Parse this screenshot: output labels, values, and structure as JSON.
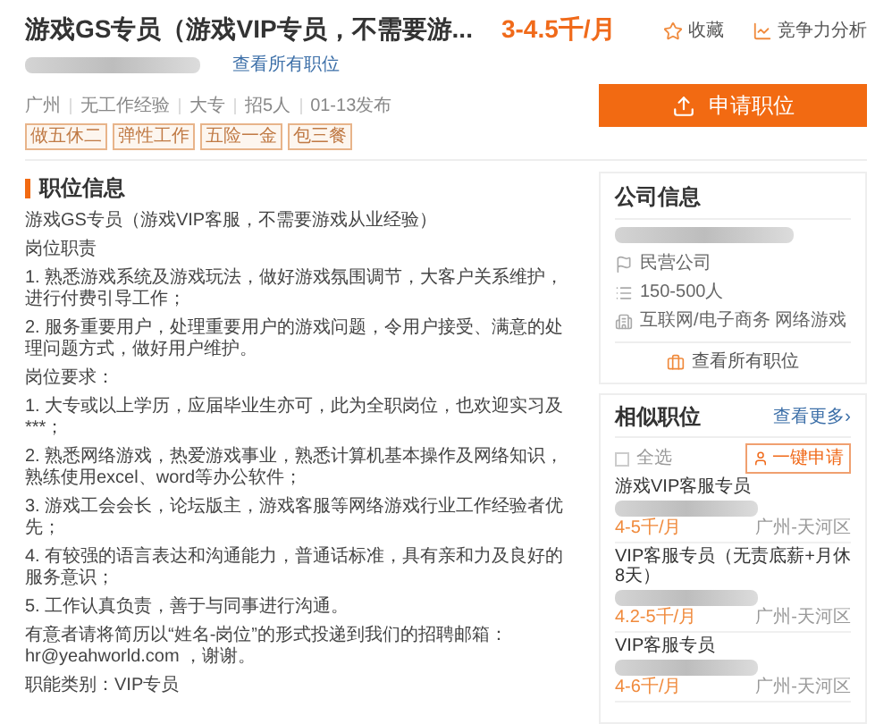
{
  "header": {
    "title": "游戏GS专员（游戏VIP专员，不需要游...",
    "salary": "3-4.5千/月",
    "view_all_link": "查看所有职位",
    "actions": [
      {
        "kind": "favorite",
        "label": "收藏"
      },
      {
        "kind": "analysis",
        "label": "竞争力分析"
      }
    ],
    "meta": [
      "广州",
      "无工作经验",
      "大专",
      "招5人",
      "01-13发布"
    ],
    "tags": [
      "做五休二",
      "弹性工作",
      "五险一金",
      "包三餐"
    ],
    "apply_button": "申请职位"
  },
  "job_info": {
    "heading": "职位信息",
    "paragraphs": [
      "游戏GS专员（游戏VIP客服，不需要游戏从业经验）",
      "岗位职责",
      "1. 熟悉游戏系统及游戏玩法，做好游戏氛围调节，大客户关系维护，进行付费引导工作；",
      "2. 服务重要用户，处理重要用户的游戏问题，令用户接受、满意的处理问题方式，做好用户维护。",
      "岗位要求：",
      "1. 大专或以上学历，应届毕业生亦可，此为全职岗位，也欢迎实习及***；",
      "2. 熟悉网络游戏，热爱游戏事业，熟悉计算机基本操作及网络知识，熟练使用excel、word等办公软件；",
      "3. 游戏工会会长，论坛版主，游戏客服等网络游戏行业工作经验者优先；",
      "4. 有较强的语言表达和沟通能力，普通话标准，具有亲和力及良好的服务意识；",
      "5. 工作认真负责，善于与同事进行沟通。",
      "有意者请将简历以“姓名-岗位”的形式投递到我们的招聘邮箱：hr@yeahworld.com ，谢谢。",
      "职能类别：VIP专员"
    ]
  },
  "company": {
    "heading": "公司信息",
    "facts": [
      {
        "kind": "type",
        "text": "民营公司"
      },
      {
        "kind": "size",
        "text": "150-500人"
      },
      {
        "kind": "industry",
        "text": "互联网/电子商务 网络游戏"
      }
    ],
    "view_all_link": "查看所有职位"
  },
  "similar": {
    "heading": "相似职位",
    "more_link": "查看更多›",
    "select_all": {
      "label": "全选",
      "checked": false
    },
    "apply_all_button": "一键申请",
    "jobs": [
      {
        "title": "游戏VIP客服专员",
        "salary": "4-5千/月",
        "location": "广州-天河区"
      },
      {
        "title": "VIP客服专员（无责底薪+月休8天）",
        "salary": "4.2-5千/月",
        "location": "广州-天河区"
      },
      {
        "title": "VIP客服专员",
        "salary": "4-6千/月",
        "location": "广州-天河区"
      }
    ]
  }
}
